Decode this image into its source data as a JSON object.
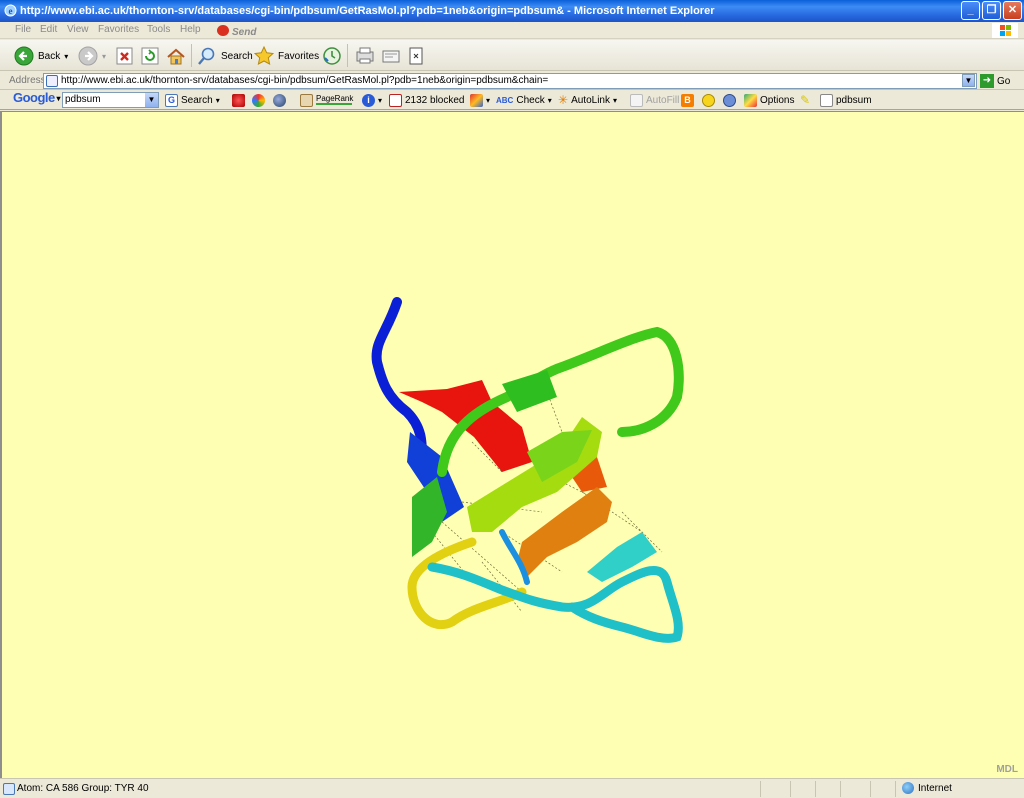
{
  "window": {
    "title": "http://www.ebi.ac.uk/thornton-srv/databases/cgi-bin/pdbsum/GetRasMol.pl?pdb=1neb&origin=pdbsum& - Microsoft Internet Explorer",
    "minimize": "_",
    "restore": "❐",
    "close": "✕"
  },
  "menu": {
    "file": "File",
    "edit": "Edit",
    "view": "View",
    "favorites": "Favorites",
    "tools": "Tools",
    "help": "Help",
    "send": "Send"
  },
  "toolbar": {
    "back": "Back",
    "search": "Search",
    "favorites": "Favorites"
  },
  "address": {
    "label": "Address",
    "url": "http://www.ebi.ac.uk/thornton-srv/databases/cgi-bin/pdbsum/GetRasMol.pl?pdb=1neb&origin=pdbsum&chain=",
    "go": "Go"
  },
  "google": {
    "logo": "Google",
    "query": "pdbsum",
    "search": "Search",
    "pagerank": "PageRank",
    "blocked": "2132 blocked",
    "check": "Check",
    "autolink": "AutoLink",
    "autofill": "AutoFill",
    "options": "Options",
    "highlight_term": "pdbsum"
  },
  "content": {
    "watermark": "MDL",
    "background": "#ffffb3"
  },
  "status": {
    "text": "Atom: CA 586  Group: TYR 40",
    "zone": "Internet"
  }
}
